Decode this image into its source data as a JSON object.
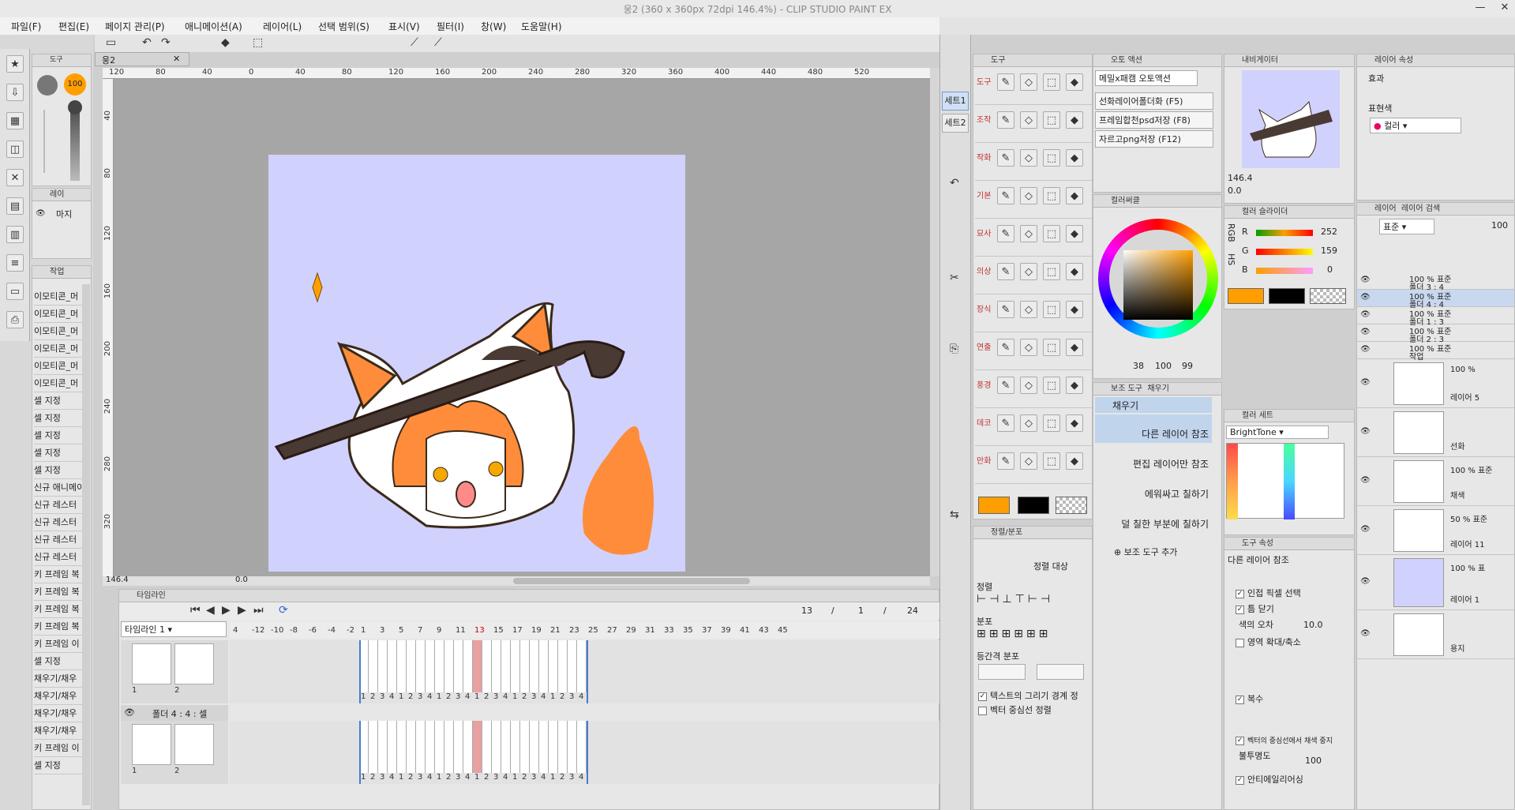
{
  "app_title": "웅2 (360 x 360px 72dpi 146.4%) - CLIP STUDIO PAINT EX",
  "menu": [
    "파일(F)",
    "편집(E)",
    "페이지 관리(P)",
    "애니메이션(A)",
    "레이어(L)",
    "선택 범위(S)",
    "표시(V)",
    "필터(I)",
    "창(W)",
    "도움말(H)"
  ],
  "doc_tab": "웅2",
  "brush_size": "100",
  "ruler_h": [
    "120",
    "80",
    "40",
    "0",
    "40",
    "80",
    "120",
    "160",
    "200",
    "240",
    "280",
    "320",
    "360",
    "400",
    "440",
    "480",
    "520"
  ],
  "ruler_v": [
    "40",
    "80",
    "120",
    "160",
    "200",
    "240",
    "280",
    "320"
  ],
  "zoom": "146.4",
  "zero": "0.0",
  "left_panel": {
    "tab": "도구",
    "layer_tab": "레이",
    "layer_item": "마지",
    "action_tab": "작업",
    "items": [
      "이모티콘_머",
      "이모티콘_머",
      "이모티콘_머",
      "이모티콘_머",
      "이모티콘_머",
      "이모티콘_머",
      "셀 지정",
      "셀 지정",
      "셀 지정",
      "셀 지정",
      "셀 지정",
      "신규 애니메이",
      "신규 레스터",
      "신규 레스터",
      "신규 레스터",
      "신규 레스터",
      "키 프레임 복",
      "키 프레임 복",
      "키 프레임 복",
      "키 프레임 복",
      "키 프레임 이",
      "셀 지정",
      "채우기/채우",
      "채우기/채우",
      "채우기/채우",
      "채우기/채우",
      "키 프레임 이",
      "셀 지정"
    ]
  },
  "tool_panel": {
    "tab": "도구",
    "cats": [
      "도구",
      "조작",
      "작화",
      "기본",
      "묘사",
      "의상",
      "장식",
      "연출",
      "풍경",
      "데코",
      "만화"
    ],
    "colors": {
      "main": "#ff9e00",
      "sub": "#000000"
    }
  },
  "sets": [
    "세트1",
    "세트2"
  ],
  "auto_action": {
    "tab": "오토 액션",
    "dropdown": "메밀x패캠 오토액션",
    "items": [
      "선화레이어폴더화 (F5)",
      "프레임합천psd저장 (F8)",
      "자르고png저장 (F12)"
    ]
  },
  "color_wheel": {
    "tab": "컬러써클",
    "readout_a": "38",
    "readout_b": "100",
    "readout_c": "99"
  },
  "sub_tool": {
    "tab": "보조 도구",
    "tab2": "채우기",
    "header": "채우기",
    "items": [
      "다른 레이어 참조",
      "편집 레이어만 참조",
      "에워싸고 칠하기",
      "덜 칠한 부분에 칠하기"
    ],
    "add_button": "보조 도구 추가"
  },
  "align_panel": {
    "tab": "정렬/분포",
    "target_label": "정렬 대상",
    "align_label": "정렬",
    "distribute_label": "분포",
    "spacing_label": "등간격 분포",
    "chk1": "텍스트의 그리기 경계 정",
    "chk2": "벡터 중심선 정렬"
  },
  "navigator": {
    "tab": "내비게이터",
    "zoom": "146.4",
    "rot": "0.0"
  },
  "color_slider": {
    "tab": "컬러 슬라이더",
    "mode": "RGB",
    "side_tabs": "HS",
    "r": "252",
    "g": "159",
    "b": "0",
    "rgb_labels": [
      "R",
      "G",
      "B"
    ],
    "main": "#ff9e00",
    "sub": "#000000"
  },
  "color_set": {
    "tab": "컬러 세트",
    "dropdown": "BrightTone"
  },
  "tool_props": {
    "tab": "도구 속성",
    "header": "다른 레이어 참조",
    "adjacent": "인접 픽셀 선택",
    "gap": "틈 닫기",
    "tolerance_label": "색의 오차",
    "tolerance": "10.0",
    "expand": "영역 확대/축소",
    "multi": "복수",
    "vector_center": "벡터의 중심선에서 채색 중지",
    "opacity_label": "불투명도",
    "opacity": "100",
    "antialias": "안티에일리어싱"
  },
  "layer_props": {
    "tab": "레이어 속성",
    "effect": "효과",
    "expression": "표현색",
    "color_mode": "컬러"
  },
  "layers": {
    "tab": "레이어",
    "tab2": "레이어 검색",
    "blend": "표준",
    "opacity": "100",
    "items": [
      {
        "mode": "100 % 표준",
        "name": "폴더 3 : 4"
      },
      {
        "mode": "100 % 표준",
        "name": "폴더 4 : 4"
      },
      {
        "mode": "100 % 표준",
        "name": "폴더 1 : 3"
      },
      {
        "mode": "100 % 표준",
        "name": "폴더 2 : 3"
      },
      {
        "mode": "100 % 표준",
        "name": "작업"
      },
      {
        "mode": "100 %",
        "name": "레이어 5"
      },
      {
        "mode": "",
        "name": "선화"
      },
      {
        "mode": "100 % 표준",
        "name": "채색"
      },
      {
        "mode": "50 % 표준",
        "name": "레이어 11"
      },
      {
        "mode": "100 % 표",
        "name": "레이어 1"
      },
      {
        "mode": "",
        "name": "용지"
      }
    ]
  },
  "timeline": {
    "tab": "타임라인",
    "dropdown": "타임라인 1",
    "current": "13",
    "slash": "/",
    "start": "1",
    "end": "24",
    "neg_ticks": [
      "4",
      "-12",
      "-10",
      "-8",
      "-6",
      "-4",
      "-2"
    ],
    "ticks": [
      "1",
      "3",
      "5",
      "7",
      "9",
      "11",
      "13",
      "15",
      "17",
      "19",
      "21",
      "23",
      "25",
      "27",
      "29",
      "31",
      "33",
      "35",
      "37",
      "39",
      "41",
      "43",
      "45"
    ],
    "track1_keys": [
      "1",
      "2",
      "3",
      "4",
      "1",
      "2",
      "3",
      "4",
      "1",
      "2",
      "3",
      "4",
      "1",
      "2",
      "3",
      "4",
      "1",
      "2",
      "3",
      "4",
      "1",
      "2",
      "3",
      "4"
    ],
    "track2_name": "폴더 4 : 4 : 셀",
    "thumb_labels": [
      "1",
      "2"
    ]
  },
  "timeline_scroll": "146.4",
  "timeline_zero": "0.0",
  "layer_mode_pct": "100 %"
}
